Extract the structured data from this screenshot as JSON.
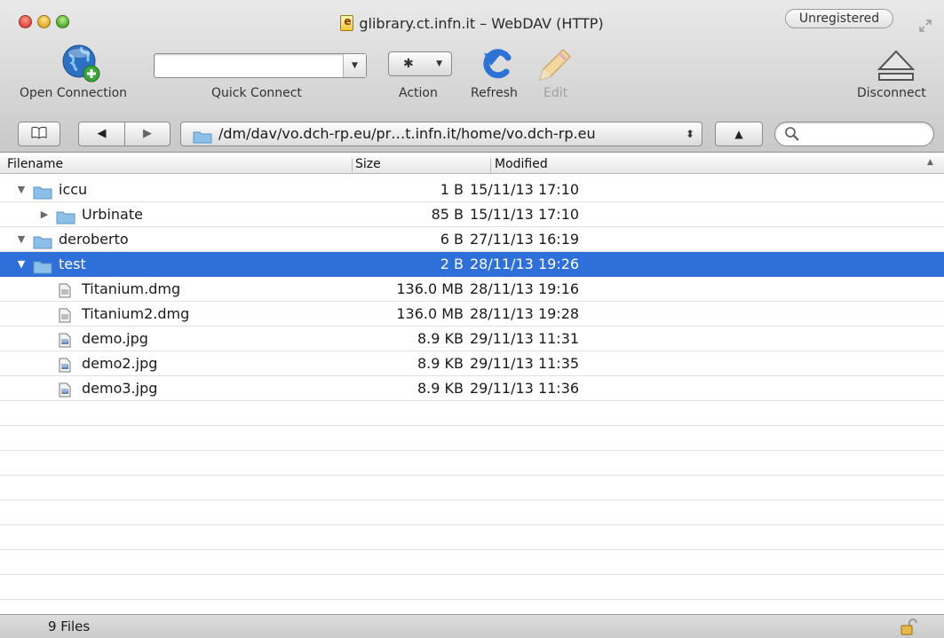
{
  "window": {
    "title": "glibrary.ct.infn.it – WebDAV (HTTP)",
    "registration_label": "Unregistered"
  },
  "toolbar": {
    "open_connection_label": "Open Connection",
    "quick_connect_label": "Quick Connect",
    "quick_connect_value": "",
    "action_label": "Action",
    "refresh_label": "Refresh",
    "edit_label": "Edit",
    "disconnect_label": "Disconnect"
  },
  "navigation": {
    "path": "/dm/dav/vo.dch-rp.eu/pr…t.infn.it/home/vo.dch-rp.eu",
    "search_value": ""
  },
  "table": {
    "columns": {
      "filename": "Filename",
      "size": "Size",
      "modified": "Modified"
    },
    "rows": [
      {
        "name": "iccu",
        "size": "1 B",
        "modified": "15/11/13 17:10",
        "kind": "folder",
        "level": 0,
        "expanded": true,
        "selected": false
      },
      {
        "name": "Urbinate",
        "size": "85 B",
        "modified": "15/11/13 17:10",
        "kind": "folder",
        "level": 1,
        "expanded": false,
        "selected": false
      },
      {
        "name": "deroberto",
        "size": "6 B",
        "modified": "27/11/13 16:19",
        "kind": "folder",
        "level": 0,
        "expanded": true,
        "selected": false
      },
      {
        "name": "test",
        "size": "2 B",
        "modified": "28/11/13 19:26",
        "kind": "folder",
        "level": 0,
        "expanded": true,
        "selected": true
      },
      {
        "name": "Titanium.dmg",
        "size": "136.0 MB",
        "modified": "28/11/13 19:16",
        "kind": "dmg",
        "level": 1,
        "expanded": false,
        "selected": false
      },
      {
        "name": "Titanium2.dmg",
        "size": "136.0 MB",
        "modified": "28/11/13 19:28",
        "kind": "dmg",
        "level": 1,
        "expanded": false,
        "selected": false
      },
      {
        "name": "demo.jpg",
        "size": "8.9 KB",
        "modified": "29/11/13 11:31",
        "kind": "image",
        "level": 1,
        "expanded": false,
        "selected": false
      },
      {
        "name": "demo2.jpg",
        "size": "8.9 KB",
        "modified": "29/11/13 11:35",
        "kind": "image",
        "level": 1,
        "expanded": false,
        "selected": false
      },
      {
        "name": "demo3.jpg",
        "size": "8.9 KB",
        "modified": "29/11/13 11:36",
        "kind": "image",
        "level": 1,
        "expanded": false,
        "selected": false
      }
    ]
  },
  "status": {
    "count_text": "9 Files"
  },
  "icons": {
    "open_connection": "globe-plus-icon",
    "action": "gear-icon",
    "refresh": "refresh-arrow-icon",
    "edit": "pencil-icon",
    "disconnect": "eject-icon",
    "bookmarks": "book-icon",
    "search": "magnifier-icon",
    "lock": "unlocked-padlock-icon"
  },
  "colors": {
    "selection": "#2f6fd9",
    "folder": "#8cc0e8"
  }
}
